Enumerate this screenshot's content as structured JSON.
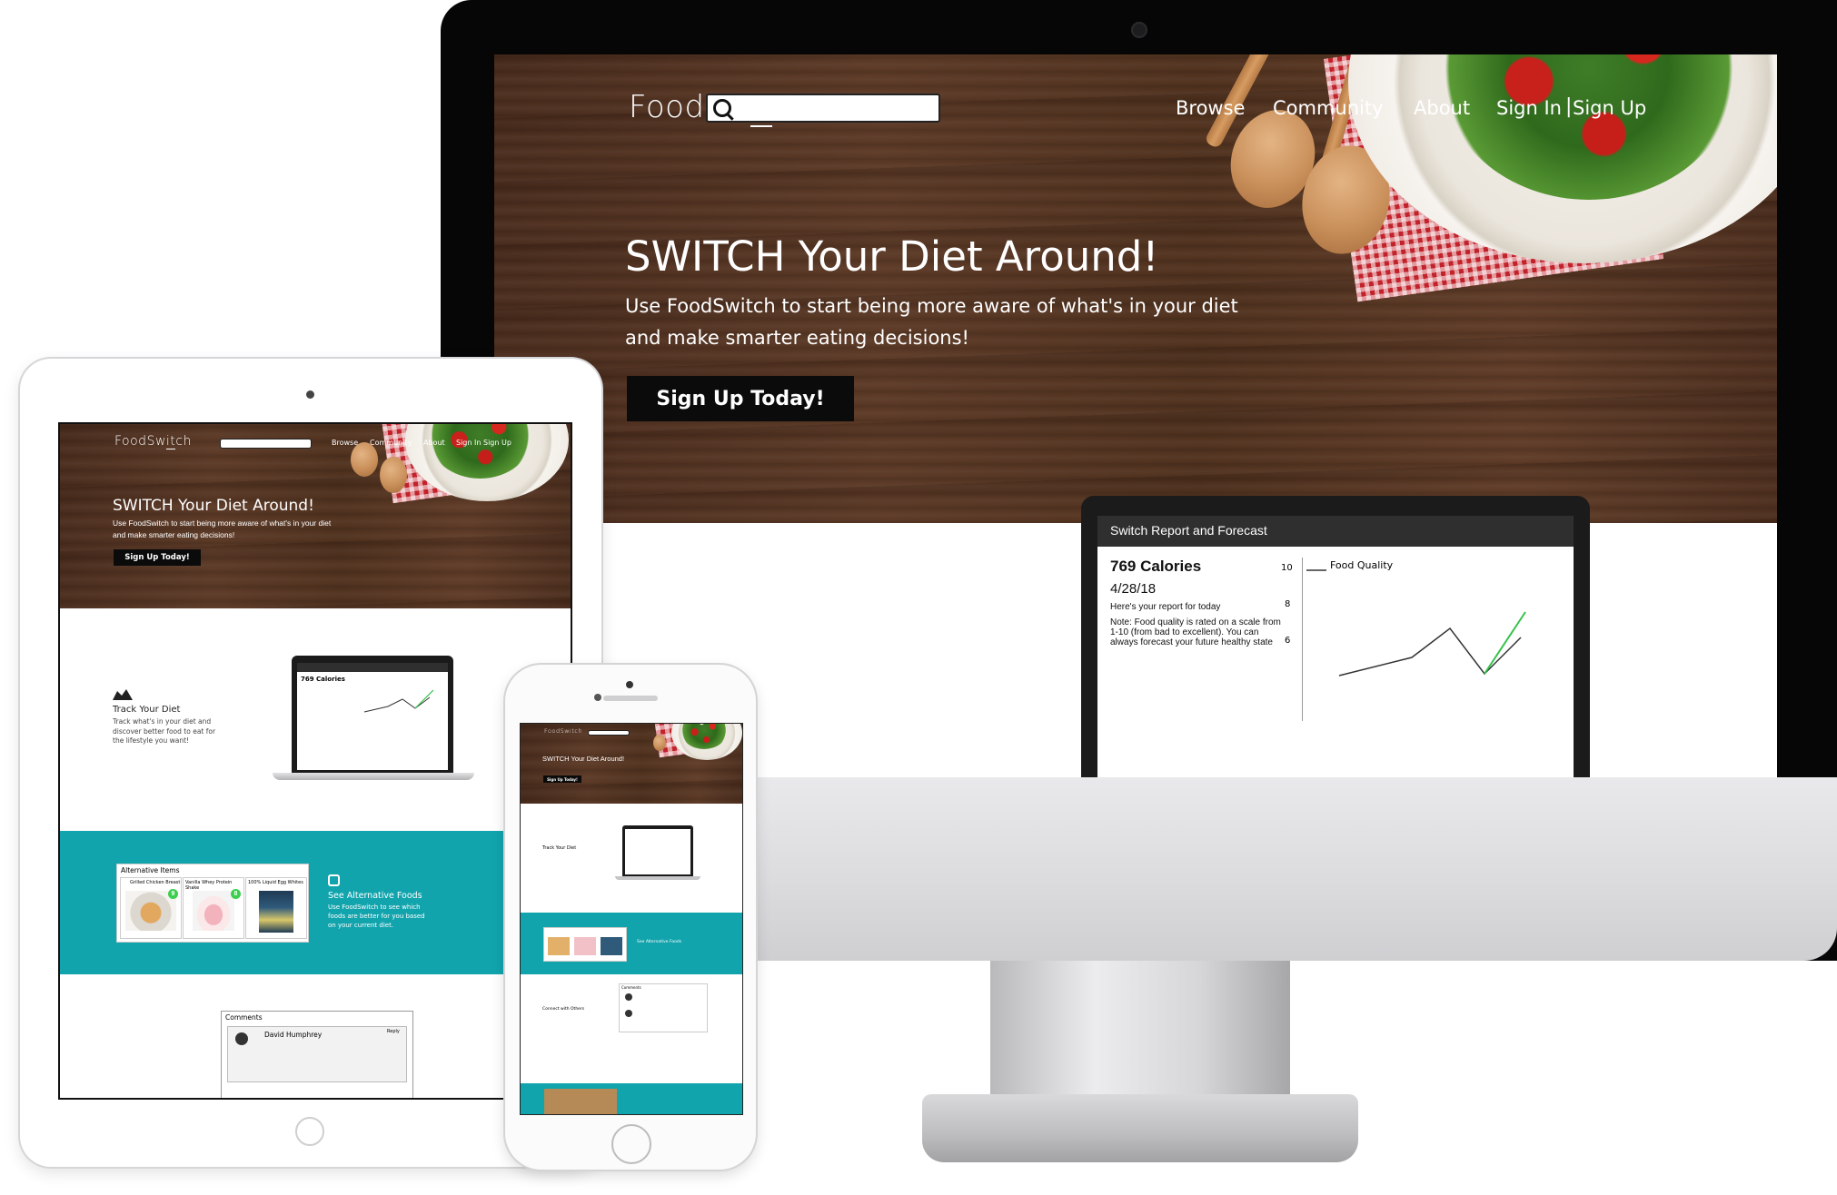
{
  "brand": {
    "logo_prefix": "FoodSw",
    "logo_mid": "it",
    "logo_suffix": "ch"
  },
  "nav": {
    "browse": "Browse",
    "community": "Community",
    "about": "About",
    "sign_in": "Sign In",
    "separator": "|",
    "sign_up": "Sign Up"
  },
  "search": {
    "placeholder": ""
  },
  "hero": {
    "title": "SWITCH Your Diet Around!",
    "subtitle_line1": "Use FoodSwitch to start being more aware of what's in your diet",
    "subtitle_line2": "and make smarter eating decisions!",
    "cta": "Sign Up Today!"
  },
  "report": {
    "title": "Switch Report and Forecast",
    "calories": "769 Calories",
    "date": "4/28/18",
    "intro": "Here's your report for today",
    "note": "Note: Food quality is rated on a scale from 1-10 (from bad to excellent). You can always forecast your future healthy state",
    "legend": "Food Quality",
    "y_ticks": [
      "10",
      "8",
      "6"
    ]
  },
  "features": {
    "track_title": "Track Your Diet",
    "track_desc": "Track what's in your diet and discover better food to eat for the lifestyle you want!",
    "alt_title": "See Alternative Foods",
    "alt_desc": "Use FoodSwitch to see which foods are better for you based on your current diet.",
    "connect_title": "Connect with Others"
  },
  "alternatives": {
    "heading": "Alternative Items",
    "items": [
      {
        "name": "Grilled Chicken Breast",
        "score": "9"
      },
      {
        "name": "Vanilla Whey Protein Shake",
        "score": "8"
      },
      {
        "name": "100% Liquid Egg Whites",
        "score": ""
      }
    ]
  },
  "comments": {
    "heading": "Comments",
    "first_author": "David Humphrey",
    "reply": "Reply"
  },
  "colors": {
    "teal": "#12a4ad",
    "score_green": "#3ccf4e",
    "dark": "#0b0b0b"
  }
}
